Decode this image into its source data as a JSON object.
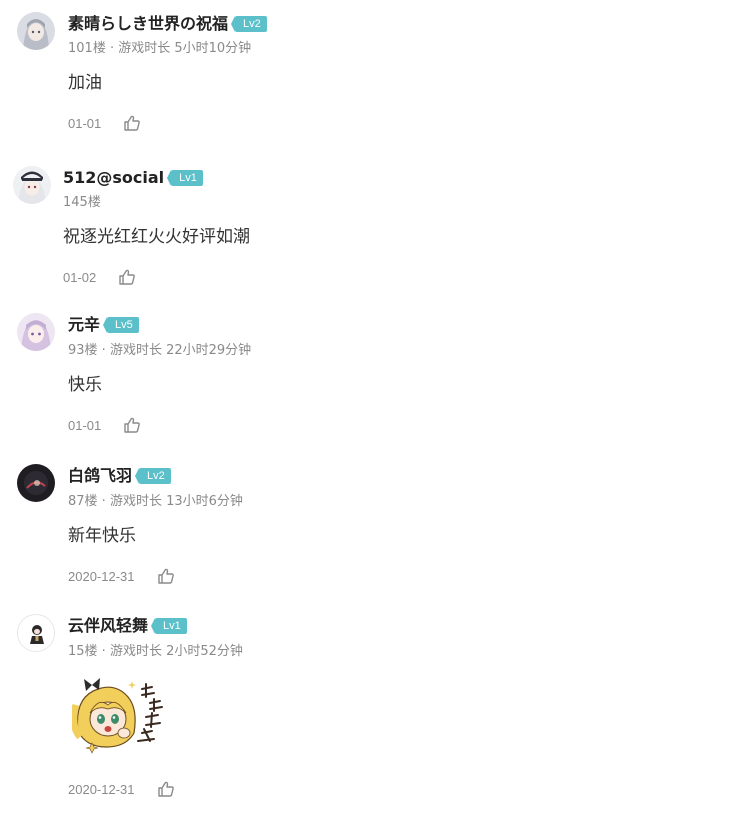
{
  "comments": [
    {
      "username": "素晴らしき世界の祝福",
      "level": "Lv2",
      "meta": "101楼 · 游戏时长 5小时10分钟",
      "content": "加油",
      "date": "01-01",
      "avatar_icon": "silver-hair-anime-avatar"
    },
    {
      "username": "512@social",
      "level": "Lv1",
      "meta": "145楼",
      "content": "祝逐光红红火火好评如潮",
      "date": "01-02",
      "avatar_icon": "white-hair-cap-anime-avatar"
    },
    {
      "username": "元辛",
      "level": "Lv5",
      "meta": "93楼 · 游戏时长 22小时29分钟",
      "content": "快乐",
      "date": "01-01",
      "avatar_icon": "lavender-hair-anime-avatar"
    },
    {
      "username": "白鸽飞羽",
      "level": "Lv2",
      "meta": "87楼 · 游戏时长 13小时6分钟",
      "content": "新年快乐",
      "date": "2020-12-31",
      "avatar_icon": "dark-glow-avatar"
    },
    {
      "username": "云伴风轻舞",
      "level": "Lv1",
      "meta": "15楼 · 游戏时长 2小时52分钟",
      "content": "",
      "sticker": "blonde-anime-girl-sticker",
      "date": "2020-12-31",
      "avatar_icon": "chibi-character-avatar"
    }
  ],
  "colors": {
    "level_badge": "#5bc0c9",
    "meta_text": "#8a8a8a",
    "username_text": "#222222"
  },
  "icons": {
    "like": "thumbs-up-icon"
  }
}
